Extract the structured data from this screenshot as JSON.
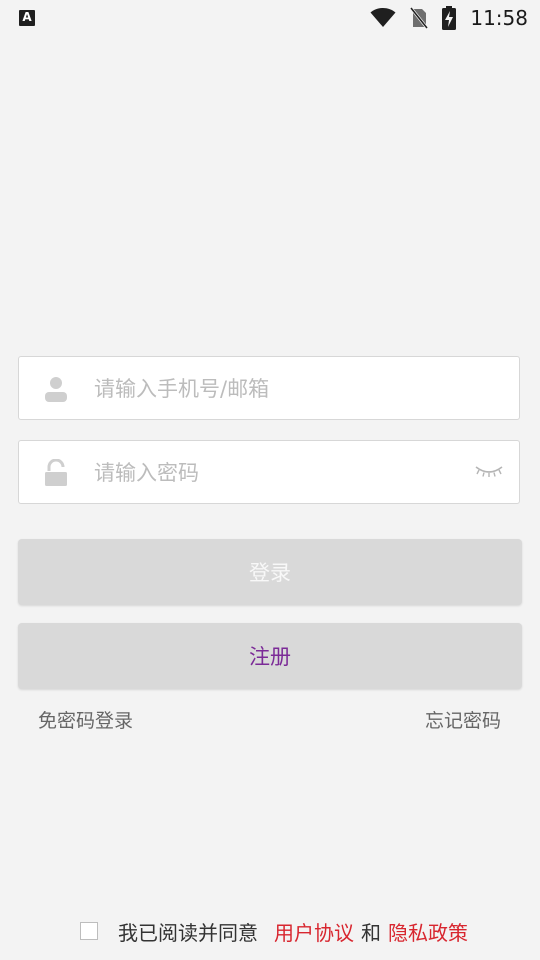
{
  "status_bar": {
    "left_icon_label": "A",
    "time": "11:58"
  },
  "form": {
    "account_placeholder": "请输入手机号/邮箱",
    "password_placeholder": "请输入密码",
    "login_label": "登录",
    "register_label": "注册",
    "sms_login_label": "免密码登录",
    "forgot_password_label": "忘记密码"
  },
  "agreement": {
    "prefix": "我已阅读并同意",
    "user_agreement": "用户协议",
    "conjunction": "和",
    "privacy_policy": "隐私政策"
  },
  "colors": {
    "background": "#f3f3f3",
    "button_bg": "#d9d9d9",
    "register_text": "#7b2a97",
    "link_red": "#d8262f"
  }
}
